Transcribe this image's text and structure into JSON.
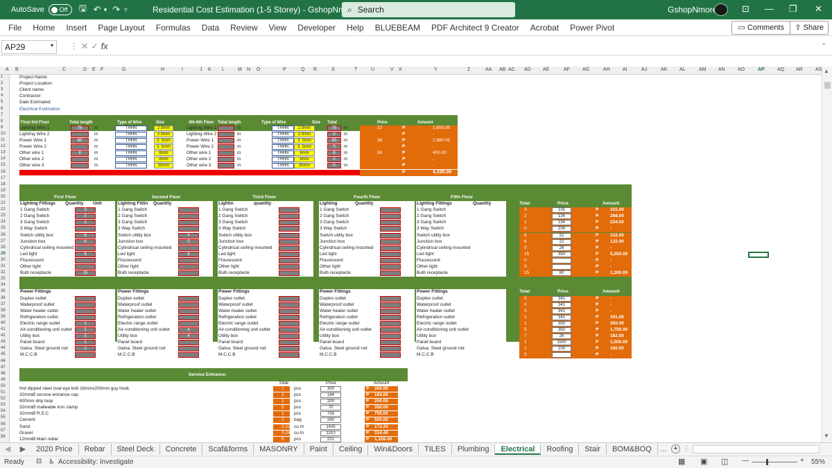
{
  "titlebar": {
    "autosave": "AutoSave",
    "toggle": "Off",
    "title": "Residential Cost Estimation (1-5 Storey) - GshopNmore",
    "search": "Search",
    "user": "GshopNmore ."
  },
  "menu": [
    "File",
    "Home",
    "Insert",
    "Page Layout",
    "Formulas",
    "Data",
    "Review",
    "View",
    "Developer",
    "Help",
    "BLUEBEAM",
    "PDF Architect 9 Creator",
    "Acrobat",
    "Power Pivot"
  ],
  "buttons": {
    "comments": "Comments",
    "share": "Share"
  },
  "formula": {
    "namebox": "AP29",
    "fx": "fx"
  },
  "columns": [
    "A",
    "B",
    "C",
    "D",
    "E",
    "F",
    "G",
    "H",
    "I",
    "J",
    "K",
    "L",
    "M",
    "N",
    "O",
    "P",
    "Q",
    "R",
    "S",
    "T",
    "U",
    "V",
    "X",
    "Y",
    "Z",
    "AA",
    "AB",
    "AC",
    "AD",
    "AE",
    "AF",
    "AG",
    "AH",
    "AI",
    "AJ",
    "AK",
    "AL",
    "AM",
    "AN",
    "AO",
    "AP",
    "AQ",
    "AR",
    "AS"
  ],
  "project": [
    "Project Name:",
    "Project Location:",
    "Client name:",
    "Contractor:",
    "Date Estimated:",
    "Electrical Estimation"
  ],
  "wires": {
    "headers": {
      "floor13": "First-3rd Floor",
      "total_length": "Total length",
      "type": "Type of Wire",
      "size": "Size",
      "floor46": "4th-6th Floor",
      "total_length2": "Total length",
      "type2": "Type of Wire",
      "size2": "Size",
      "total": "Total",
      "price": "Price",
      "amount": "Amount"
    },
    "rows": [
      {
        "name": "Lighting Wire 1",
        "len": "75",
        "unit": "m",
        "type": "THHN",
        "size": "2.0mm",
        "name2": "Lighting Wire 1",
        "unit2": "m",
        "type2": "THHN",
        "size2": "2.0mm",
        "total": "75",
        "tunit": "m",
        "price": "22",
        "peso": "₱",
        "amount": "1,650.00"
      },
      {
        "name": "Lighting Wire 2",
        "len": "",
        "unit": "m",
        "type": "THHN",
        "size": "2.0mm",
        "name2": "Lighting Wire 2",
        "unit2": "m",
        "type2": "THHN",
        "size2": "2.0mm",
        "total": "0",
        "tunit": "m",
        "price": "",
        "peso": "₱",
        "amount": "-"
      },
      {
        "name": "Power Wire 1",
        "len": "80",
        "unit": "m",
        "type": "THHN",
        "size": "3. 5mm",
        "name2": "Power Wire 1",
        "unit2": "m",
        "type2": "THHN",
        "size2": "3. 5mm",
        "total": "80",
        "tunit": "m",
        "price": "36",
        "peso": "₱",
        "amount": "2,880.00"
      },
      {
        "name": "Power Wire 2",
        "len": "",
        "unit": "m",
        "type": "THHN",
        "size": "3. 5mm",
        "name2": "Power Wire 2",
        "unit2": "m",
        "type2": "THHN",
        "size2": "3. 5mm",
        "total": "0",
        "tunit": "m",
        "price": "",
        "peso": "₱",
        "amount": "-"
      },
      {
        "name": "Other wire 1",
        "len": "8",
        "unit": "m",
        "type": "THHN",
        "size": "8mm",
        "name2": "Other wire 1",
        "unit2": "m",
        "type2": "THHN",
        "size2": "8mm",
        "total": "8",
        "tunit": "m",
        "price": "50",
        "peso": "₱",
        "amount": "400.00"
      },
      {
        "name": "Other wire 2",
        "len": "",
        "unit": "m",
        "type": "THHN",
        "size": "8mm",
        "name2": "Other wire 2",
        "unit2": "m",
        "type2": "THHN",
        "size2": "8mm",
        "total": "0",
        "tunit": "m",
        "price": "",
        "peso": "₱",
        "amount": "-"
      },
      {
        "name": "Other wire 3",
        "len": "",
        "unit": "m",
        "type": "THHN",
        "size": "30mm",
        "name2": "Other wire 3",
        "unit2": "m",
        "type2": "THHN",
        "size2": "30mm",
        "total": "0",
        "tunit": "m",
        "price": "",
        "peso": "₱",
        "amount": "-"
      }
    ],
    "grand": "4,330.00",
    "peso": "₱"
  },
  "floors": [
    "First Floor",
    "Second Floor",
    "Third Floor",
    "Fourth Floor",
    "Fifth Floor"
  ],
  "lighting": {
    "head1": [
      "Lighting Fittings",
      "Lighting Fittin",
      "Lightin",
      "Lighting",
      "Lighting Fittings"
    ],
    "head2": [
      "Quantity",
      "Quantity",
      "quantity",
      "Quantity",
      "Quantity"
    ],
    "unit": "Unit",
    "items": [
      "1 Gang Switch",
      "2 Gang Switch",
      "3 Gang Switch",
      "3 Way Switch",
      "Switch utility box",
      "Junction box",
      "Cylindrical ceiling mounted",
      "Led light",
      "Flourescent",
      "Other light",
      "Bulb receptacle"
    ],
    "qty1": [
      "3",
      "2",
      "1",
      "",
      "6",
      "6",
      "",
      "9",
      "",
      "",
      "15"
    ],
    "qty2": [
      "",
      "",
      "",
      "",
      "0",
      "0",
      "",
      "6",
      "",
      "",
      ""
    ],
    "totals": [
      "3",
      "2",
      "1",
      "0",
      "6",
      "6",
      "0",
      "15",
      "0",
      "0",
      "15"
    ],
    "prices": [
      "105",
      "134",
      "234",
      "234",
      "22",
      "22",
      "26",
      "350",
      "",
      "",
      "80"
    ],
    "amounts": [
      "315.00",
      "268.00",
      "234.00",
      "-",
      "132.00",
      "132.00",
      "-",
      "5,250.00",
      "-",
      "-",
      "1,200.00"
    ],
    "total_label": "Total",
    "price_label": "Price",
    "amount_label": "Amount"
  },
  "power": {
    "head": "Power Fittings",
    "items": [
      "Duplex outlet",
      "Waterproof outlet",
      "Water heater outlet",
      "Refrigeration outlet",
      "Electric range outlet",
      "Air-conditioning unit outlet",
      "Utility box",
      "Panel board",
      "Galva. Steel ground rod",
      "M.C.C.B"
    ],
    "qty1": [
      "",
      "",
      "",
      "",
      "1",
      "1",
      "3",
      "1",
      "1",
      ""
    ],
    "qty2": [
      "",
      "",
      "",
      "",
      "",
      "4",
      "4",
      "",
      "",
      ""
    ],
    "totals": [
      "0",
      "0",
      "0",
      "1",
      "1",
      "5",
      "7",
      "1",
      "1",
      "0"
    ],
    "prices": [
      "341",
      "341",
      "341",
      "341",
      "350",
      "350",
      "26",
      "1500",
      "100",
      ""
    ],
    "amounts": [
      "-",
      "-",
      "-",
      "341.00",
      "350.00",
      "1,750.00",
      "182.00",
      "1,500.00",
      "100.00",
      "-"
    ]
  },
  "service": {
    "title": "Service Entrance:",
    "total_label": "Total",
    "price_label": "Price",
    "amount_label": "Amount",
    "rows": [
      {
        "item": "Hot dipped steel oval eye bolt 16mmx200mm guy hook",
        "qty": "1",
        "unit": "pcs",
        "price": "300",
        "amount": "300.00"
      },
      {
        "item": "32mmØ service entrance cap",
        "qty": "1",
        "unit": "pcs",
        "price": "184",
        "amount": "184.00"
      },
      {
        "item": "600mm drip loop",
        "qty": "1",
        "unit": "pcs",
        "price": "200",
        "amount": "200.00"
      },
      {
        "item": "32mmØ malleable iron clamp",
        "qty": "5",
        "unit": "pcs",
        "price": "70",
        "amount": "350.00"
      },
      {
        "item": "32mmØ R.S.C",
        "qty": "1",
        "unit": "pcs",
        "price": "755",
        "amount": "755.00"
      },
      {
        "item": "Cement",
        "qty": "2",
        "unit": "bag",
        "price": "250",
        "amount": "500.00"
      },
      {
        "item": "Sand",
        "qty": "0.12",
        "unit": "cu.m",
        "price": "1435",
        "amount": "172.20"
      },
      {
        "item": "Gravel",
        "qty": "0.24",
        "unit": "cu.m",
        "price": "1310",
        "amount": "314.40"
      },
      {
        "item": "12mmØ Main rebar",
        "qty": "6",
        "unit": "pcs",
        "price": "221",
        "amount": "1,326.00"
      }
    ]
  },
  "tabs": [
    "2020 Price",
    "Rebar",
    "Steel Deck",
    "Concrete",
    "Scaf&forms",
    "MASONRY",
    "Paint",
    "Ceiling",
    "Win&Doors",
    "TILES",
    "Plumbing",
    "Electrical",
    "Roofing",
    "Stair",
    "BOM&BOQ"
  ],
  "active_tab": "Electrical",
  "status": {
    "ready": "Ready",
    "accessibility": "Accessibility: Investigate",
    "zoom": "55%"
  }
}
